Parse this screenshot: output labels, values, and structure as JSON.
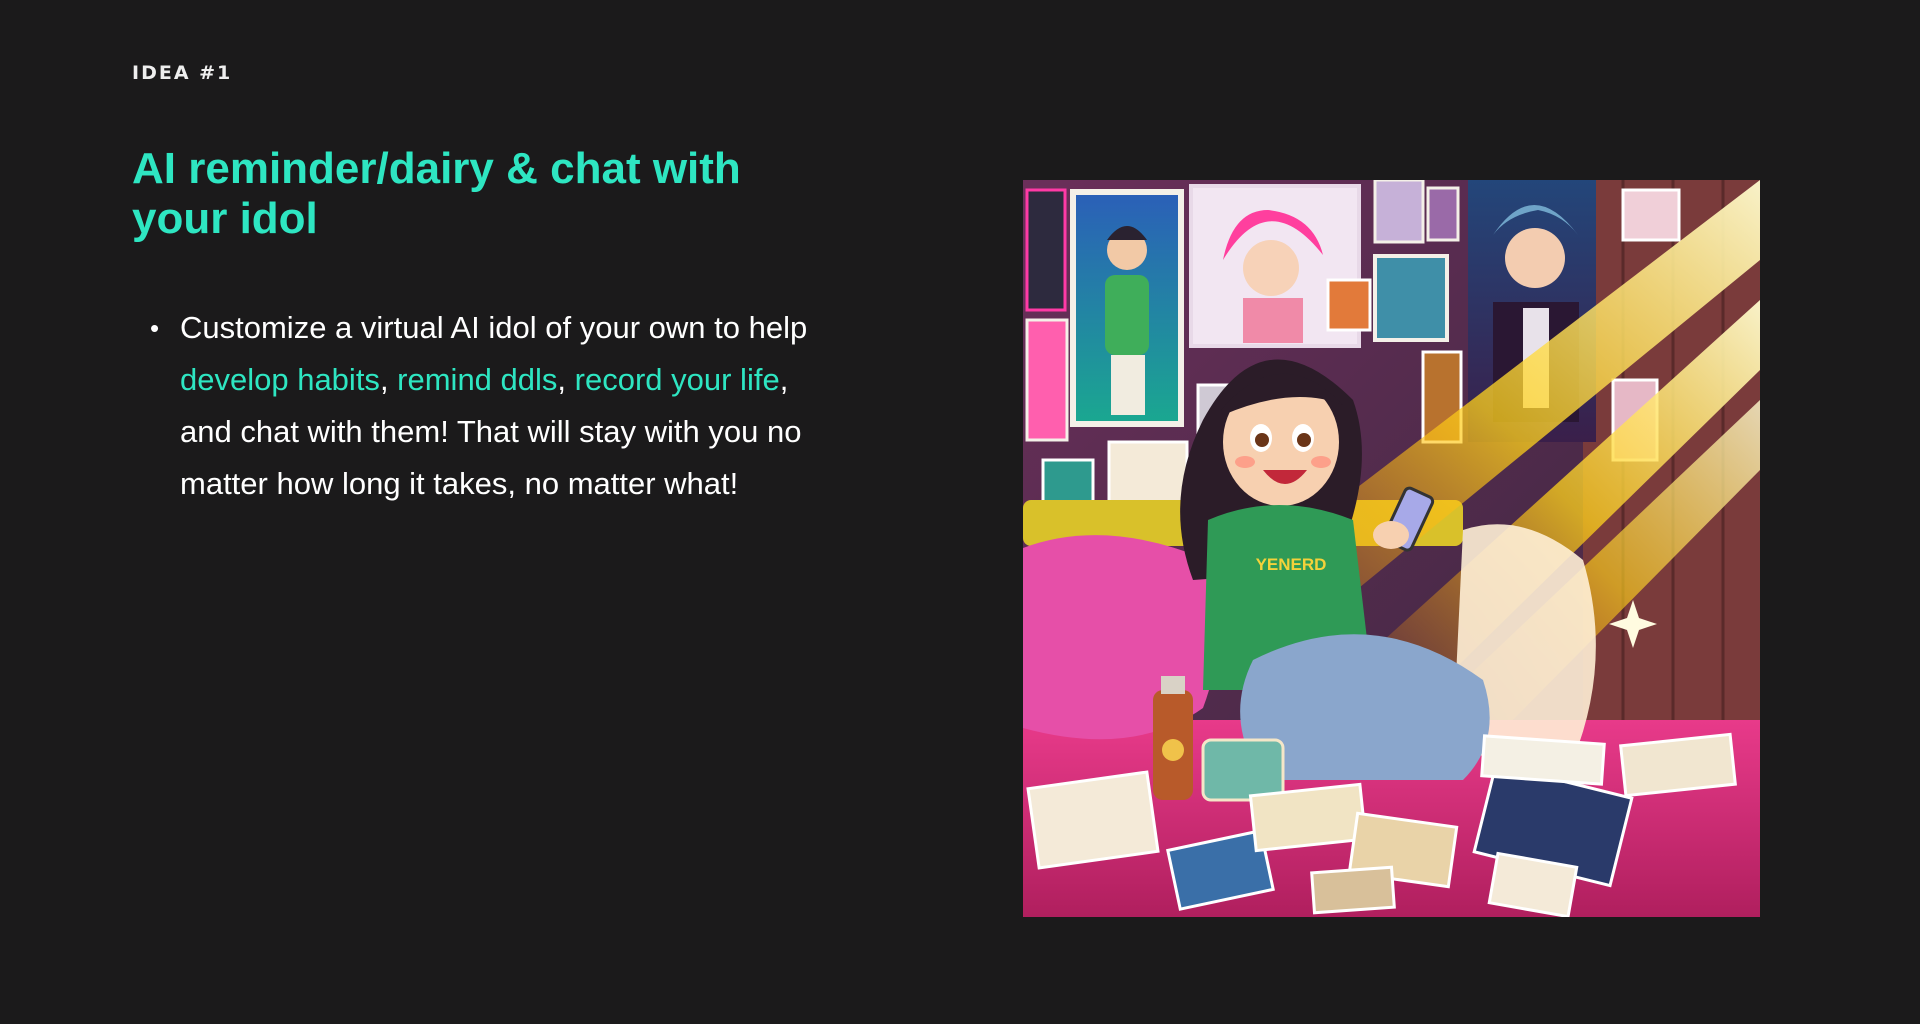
{
  "slide": {
    "eyebrow": "IDEA #1",
    "title": "AI reminder/dairy & chat with your idol",
    "bullet": {
      "intro": "Customize a virtual AI idol of your own to help ",
      "highlight_1": "develop habits",
      "sep_1": ", ",
      "highlight_2": "remind ddls",
      "sep_2": ", ",
      "highlight_3": "record your life",
      "outro": ", and chat with them! That will stay with you no matter how long it takes, no matter what!"
    },
    "illustration": {
      "shirt_text": "YENERD"
    }
  },
  "colors": {
    "background": "#1b1a1b",
    "accent": "#2ee6c2",
    "text": "#ffffff"
  }
}
